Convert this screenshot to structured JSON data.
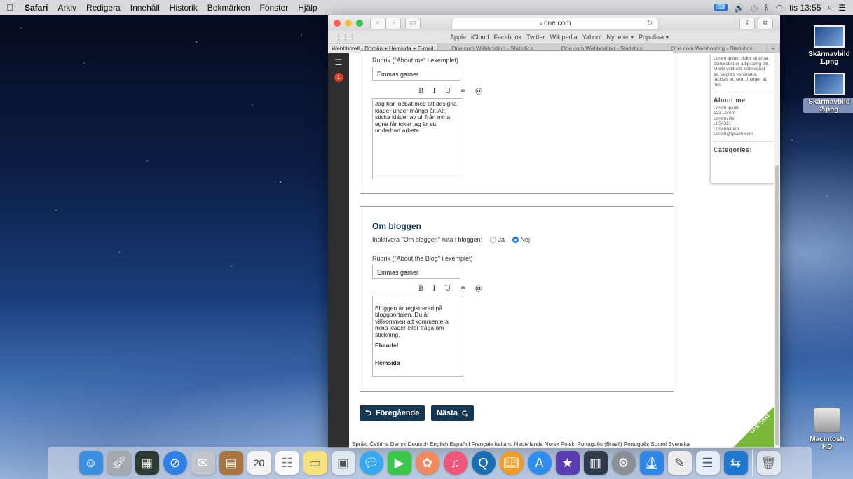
{
  "menubar": {
    "apple": "",
    "app": "Safari",
    "items": [
      "Arkiv",
      "Redigera",
      "Innehåll",
      "Historik",
      "Bokmärken",
      "Fönster",
      "Hjälp"
    ],
    "clock": "tis 13:55"
  },
  "desktop": {
    "icons": [
      {
        "label": "Skärmavbild 1.png"
      },
      {
        "label": "Skärmavbild 2.png"
      }
    ],
    "hdd_label": "Macintosh HD"
  },
  "browser": {
    "url": "one.com",
    "favorites": [
      "Apple",
      "iCloud",
      "Facebook",
      "Twitter",
      "Wikipedia",
      "Yahoo!",
      "Nyheter ▾",
      "Populära ▾"
    ],
    "tabs": [
      "Webbhotell - Domän + Hemsida + E-mail",
      "One.com Webhosting - Statistics",
      "One.com Webhosting - Statistics",
      "One.com Webhosting - Statistics"
    ]
  },
  "sidebar": {
    "badge": "1"
  },
  "about_me_section": {
    "heading_label": "Rubrik (\"About me\" i exemplet)",
    "heading_value": "Emmas garner",
    "toolbar": "B I U ⚭ @",
    "text": "Jag har jobbat med att designa kläder under många år. Att sticka kläder av ull från mina egna får tcker jag är ett underbart arbete."
  },
  "about_blog_section": {
    "title": "Om bloggen",
    "disable_label": "Inaktivera \"Om bloggen\"-ruta i bloggen:",
    "option_yes": "Ja",
    "option_no": "Nej",
    "selected": "Nej",
    "heading_label": "Rubrik (\"About the Blog\" i exemplet)",
    "heading_value": "Emmas garner",
    "toolbar": "B I U ⚭ @",
    "text": "Bloggen är registrerad på bloggportalen. Du är välkommen att kommentera mina kläder eller fråga om stickning.",
    "link1": "Ehandel",
    "link2": "Hemsida"
  },
  "preview": {
    "lorem": "Lorem ipsum dolor sit amet, consectetuer adipiscing elit. Morbi velit est, consequat ac, sagittis venenatis, facilisis et, sem. Integer ac nisl.",
    "about_title": "About me",
    "about_text": "Lorem ipsum\n123 Lorem\nLoremville\nLI 54321\nLoremnation\nLorem@ipsum.com",
    "categories_title": "Categories:"
  },
  "nav": {
    "prev": "Föregående",
    "next": "Nästa"
  },
  "live_chat": "LIVE CHAT",
  "footer_text": "Språk: Čeština Dansk Deutsch English Español Français Italiano Nederlands Norsk Polski Português (Brasil) Português Suomi Svenska"
}
